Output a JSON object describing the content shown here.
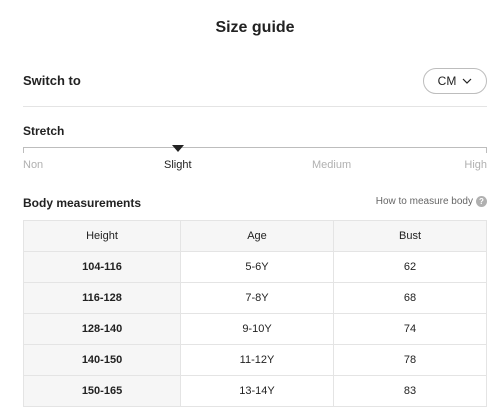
{
  "header": {
    "title": "Size guide"
  },
  "unit_switch": {
    "label": "Switch to",
    "selected": "CM"
  },
  "stretch": {
    "title": "Stretch",
    "levels": [
      "Non",
      "Slight",
      "Medium",
      "High"
    ],
    "selected": "Slight"
  },
  "measurements": {
    "title": "Body measurements",
    "help_link": "How to measure body",
    "help_icon": "?",
    "columns": [
      "Height",
      "Age",
      "Bust"
    ],
    "rows": [
      [
        "104-116",
        "5-6Y",
        "62"
      ],
      [
        "116-128",
        "7-8Y",
        "68"
      ],
      [
        "128-140",
        "9-10Y",
        "74"
      ],
      [
        "140-150",
        "11-12Y",
        "78"
      ],
      [
        "150-165",
        "13-14Y",
        "83"
      ]
    ]
  }
}
